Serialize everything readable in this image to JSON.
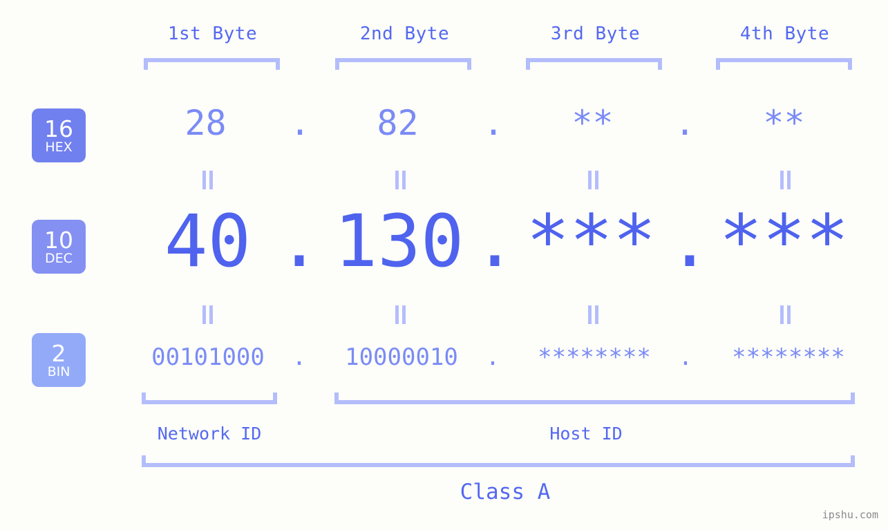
{
  "background_color": "#fdfefa",
  "accent_color": "#5468f0",
  "value_color": "#7b8bf5",
  "bracket_color": "#b4bdfb",
  "byte_headers": [
    {
      "label": "1st Byte"
    },
    {
      "label": "2nd Byte"
    },
    {
      "label": "3rd Byte"
    },
    {
      "label": "4th Byte"
    }
  ],
  "bases": [
    {
      "num": "16",
      "abbr": "HEX",
      "color": "#7080ef"
    },
    {
      "num": "10",
      "abbr": "DEC",
      "color": "#8490f2"
    },
    {
      "num": "2",
      "abbr": "BIN",
      "color": "#93aaf8"
    }
  ],
  "separator": ".",
  "equals_glyph": "=",
  "rows": {
    "hex": {
      "base": "16",
      "name": "HEX",
      "octets": [
        "28",
        "82",
        "**",
        "**"
      ]
    },
    "dec": {
      "base": "10",
      "name": "DEC",
      "octets": [
        "40",
        "130",
        "***",
        "***"
      ]
    },
    "bin": {
      "base": "2",
      "name": "BIN",
      "octets": [
        "00101000",
        "10000010",
        "********",
        "********"
      ]
    }
  },
  "sections": {
    "network_id": "Network ID",
    "host_id": "Host ID",
    "class": "Class A"
  },
  "watermark": "ipshu.com"
}
